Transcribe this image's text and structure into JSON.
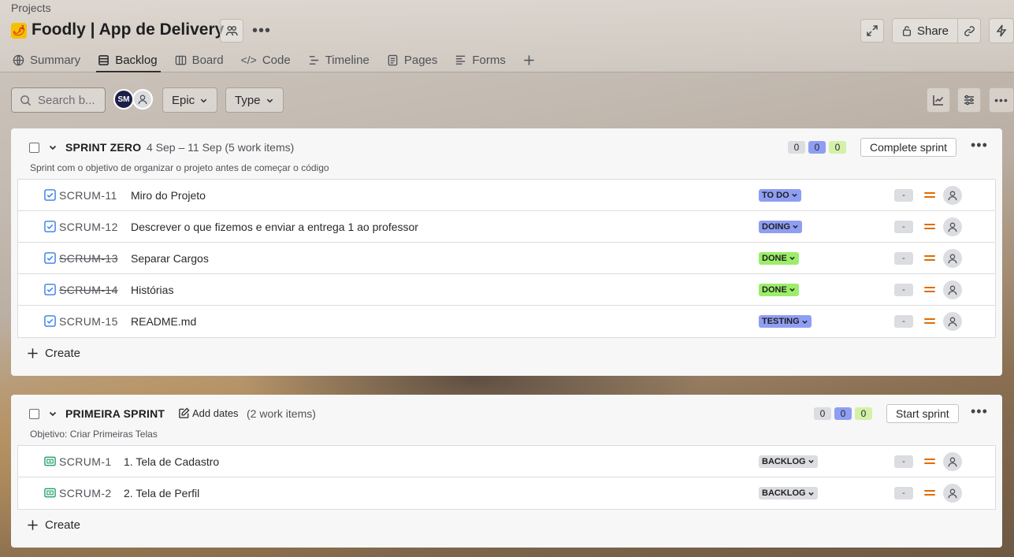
{
  "breadcrumb": "Projects",
  "project": {
    "title": "Foodly | App de Delivery"
  },
  "header": {
    "share_label": "Share"
  },
  "tabs": [
    {
      "label": "Summary",
      "icon": "globe-icon"
    },
    {
      "label": "Backlog",
      "icon": "backlog-icon"
    },
    {
      "label": "Board",
      "icon": "board-icon"
    },
    {
      "label": "Code",
      "icon": "code-icon"
    },
    {
      "label": "Timeline",
      "icon": "timeline-icon"
    },
    {
      "label": "Pages",
      "icon": "pages-icon"
    },
    {
      "label": "Forms",
      "icon": "forms-icon"
    }
  ],
  "toolbar": {
    "search_placeholder": "Search b...",
    "avatar_initials": "SM",
    "epic_label": "Epic",
    "type_label": "Type"
  },
  "sprints": [
    {
      "name": "SPRINT ZERO",
      "meta": "4 Sep – 11 Sep (5 work items)",
      "goal": "Sprint com o objetivo de organizar o projeto antes de começar o código",
      "counts": [
        "0",
        "0",
        "0"
      ],
      "action_label": "Complete sprint",
      "items": [
        {
          "key": "SCRUM-11",
          "summary": "Miro do Projeto",
          "status": "TO DO",
          "status_color": "#8f9ef3",
          "estimate": "-",
          "done": false
        },
        {
          "key": "SCRUM-12",
          "summary": "Descrever o que fizemos e enviar a entrega 1 ao professor",
          "status": "DOING",
          "status_color": "#8f9ef3",
          "estimate": "-",
          "done": false
        },
        {
          "key": "SCRUM-13",
          "summary": "Separar Cargos",
          "status": "DONE",
          "status_color": "#9bed6a",
          "estimate": "-",
          "done": true
        },
        {
          "key": "SCRUM-14",
          "summary": "Histórias",
          "status": "DONE",
          "status_color": "#9bed6a",
          "estimate": "-",
          "done": true
        },
        {
          "key": "SCRUM-15",
          "summary": "README.md",
          "status": "TESTING",
          "status_color": "#8f9ef3",
          "estimate": "-",
          "done": false
        }
      ],
      "create_label": "Create"
    },
    {
      "name": "PRIMEIRA SPRINT",
      "add_dates_label": "Add dates",
      "meta": "(2 work items)",
      "goal": "Objetivo: Criar Primeiras Telas",
      "counts": [
        "0",
        "0",
        "0"
      ],
      "action_label": "Start sprint",
      "items": [
        {
          "key": "SCRUM-1",
          "summary": "1. Tela de Cadastro",
          "status": "BACKLOG",
          "status_color": "#dcdde0",
          "estimate": "-",
          "done": false
        },
        {
          "key": "SCRUM-2",
          "summary": "2. Tela de Perfil",
          "status": "BACKLOG",
          "status_color": "#dcdde0",
          "estimate": "-",
          "done": false
        }
      ],
      "create_label": "Create"
    }
  ],
  "colors": {
    "count_gray": "#dcdde0",
    "count_blue": "#8f9ef3",
    "count_green": "#d3f1a7",
    "task_icon": "#357de8",
    "story_icon": "#22a06b",
    "priority_medium": "#e06c00"
  }
}
